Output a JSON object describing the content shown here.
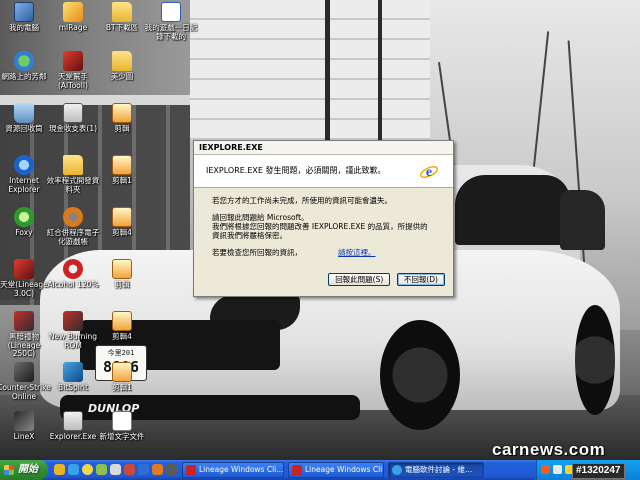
{
  "desktop": {
    "icons": [
      {
        "label": "我的電腦"
      },
      {
        "label": "mIRage"
      },
      {
        "label": "BT下載區"
      },
      {
        "label": "我的遊戲一日記錄下載的"
      },
      {
        "label": "網路上的芳鄰"
      },
      {
        "label": "天堂幫手(AIToolI)"
      },
      {
        "label": "美少圖"
      },
      {
        "label": "資源回收筒"
      },
      {
        "label": "現金收支表(1)"
      },
      {
        "label": "剪輯"
      },
      {
        "label": "Internet Explorer"
      },
      {
        "label": "效率程式開發資料夾"
      },
      {
        "label": "剪輯1"
      },
      {
        "label": "Foxy"
      },
      {
        "label": "紅合併程序電子化遊戲帳"
      },
      {
        "label": "剪輯4"
      },
      {
        "label": "天堂(Lineage 3.0C)"
      },
      {
        "label": "Alcohol 120%"
      },
      {
        "label": "剪輯"
      },
      {
        "label": "黑暗禮物(Lineage 250C)"
      },
      {
        "label": "New Burning ROM"
      },
      {
        "label": "剪輯4"
      },
      {
        "label": "Counter-Strike Online"
      },
      {
        "label": "BitSpirit"
      },
      {
        "label": "剪輯1"
      },
      {
        "label": "LineX"
      },
      {
        "label": "Explorer.Exe"
      },
      {
        "label": "新增文字文件"
      }
    ]
  },
  "wallpaper": {
    "plate_top": "今里201",
    "plate_num": "8806",
    "sticker": "DUNLOP",
    "watermark": "carnews.com"
  },
  "dialog": {
    "title": "IEXPLORE.EXE",
    "header": "IEXPLORE.EXE 發生問題，必須關閉，謹此致歉。",
    "line1": "若您方才的工作尚未完成，所使用的資訊可能會遺失。",
    "line2": "請回報此問題給 Microsoft。",
    "line3": "我們將根據您回報的問題改善 IEXPLORE.EXE 的品質，所提供的資訊我們將嚴格保密。",
    "line4": "若要檢查您所回報的資訊，",
    "link": "請按這裡。",
    "send_button": "回報此問題(S)",
    "dont_send_button": "不回報(D)"
  },
  "taskbar": {
    "start_label": "開始",
    "tasks": [
      {
        "label": "Lineage Windows Cli..."
      },
      {
        "label": "Lineage Windows Cli..."
      },
      {
        "label": "電腦軟件討論 - 維..."
      }
    ],
    "badge": "#1320247"
  },
  "colors": {
    "taskbar_blue": "#245edb",
    "start_green": "#2f8f2f",
    "dialog_bg": "#ece9d8",
    "link_blue": "#0b36b3"
  }
}
